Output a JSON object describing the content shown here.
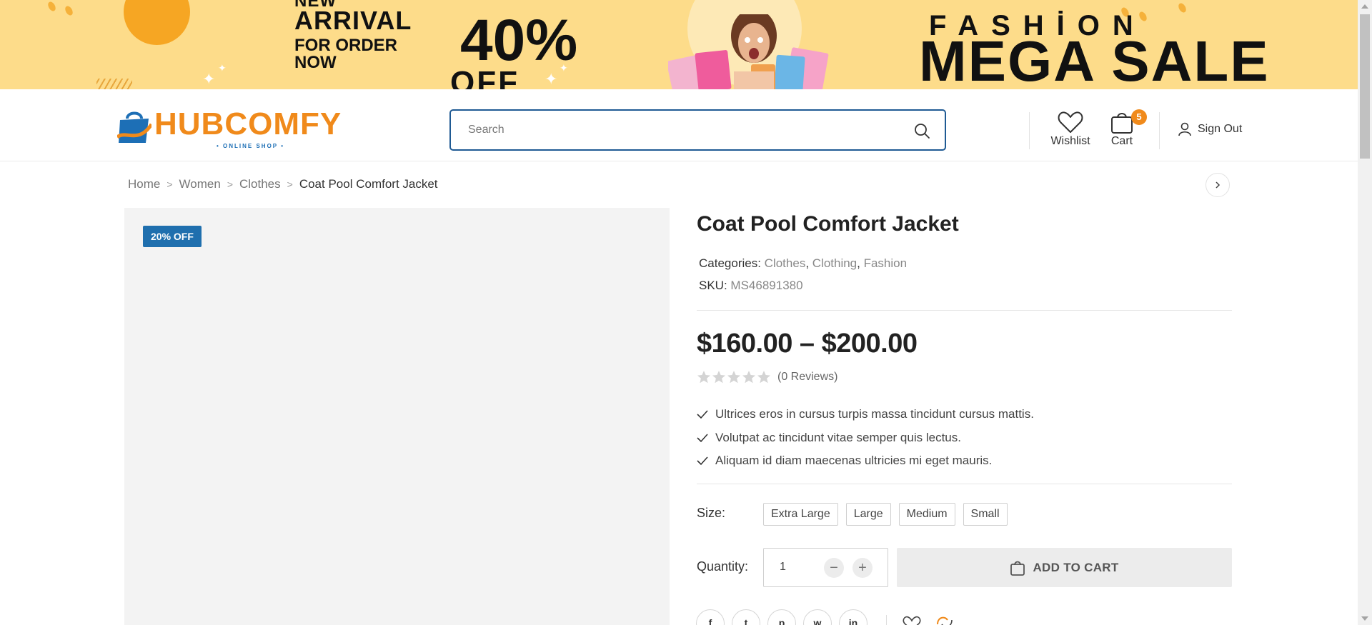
{
  "banner": {
    "new_label": "NEW",
    "arrival": "ARRIVAL",
    "for_order_line1": "FOR ORDER",
    "for_order_line2": "NOW",
    "percent": "40%",
    "off": "OFF",
    "fashion": "FASHİON",
    "mega_sale": "MEGA SALE"
  },
  "header": {
    "logo_name": "HUBCOMFY",
    "logo_tagline": "• ONLINE SHOP •",
    "search_placeholder": "Search",
    "wishlist_label": "Wishlist",
    "cart_label": "Cart",
    "cart_count": "5",
    "signout_label": "Sign Out"
  },
  "breadcrumb": {
    "items": [
      "Home",
      "Women",
      "Clothes"
    ],
    "current": "Coat Pool Comfort Jacket"
  },
  "product": {
    "discount_badge": "20% OFF",
    "title": "Coat Pool Comfort Jacket",
    "categories_label": "Categories:",
    "categories": [
      "Clothes",
      "Clothing",
      "Fashion"
    ],
    "sku_label": "SKU:",
    "sku": "MS46891380",
    "price_range": "$160.00 – $200.00",
    "rating": 0,
    "reviews_text": "(0 Reviews)",
    "features": [
      "Ultrices eros in cursus turpis massa tincidunt cursus mattis.",
      "Volutpat ac tincidunt vitae semper quis lectus.",
      "Aliquam id diam maecenas ultricies mi eget mauris."
    ],
    "size_label": "Size:",
    "sizes": [
      "Extra Large",
      "Large",
      "Medium",
      "Small"
    ],
    "quantity_label": "Quantity:",
    "quantity_value": "1",
    "add_to_cart_label": "ADD TO CART",
    "share": {
      "facebook": "f",
      "twitter": "t",
      "pinterest": "p",
      "whatsapp": "w",
      "linkedin": "in"
    }
  },
  "colors": {
    "banner_bg": "#fddc8a",
    "brand_orange": "#f08a1b",
    "brand_blue": "#1f6fae",
    "search_border": "#1f5a93"
  }
}
